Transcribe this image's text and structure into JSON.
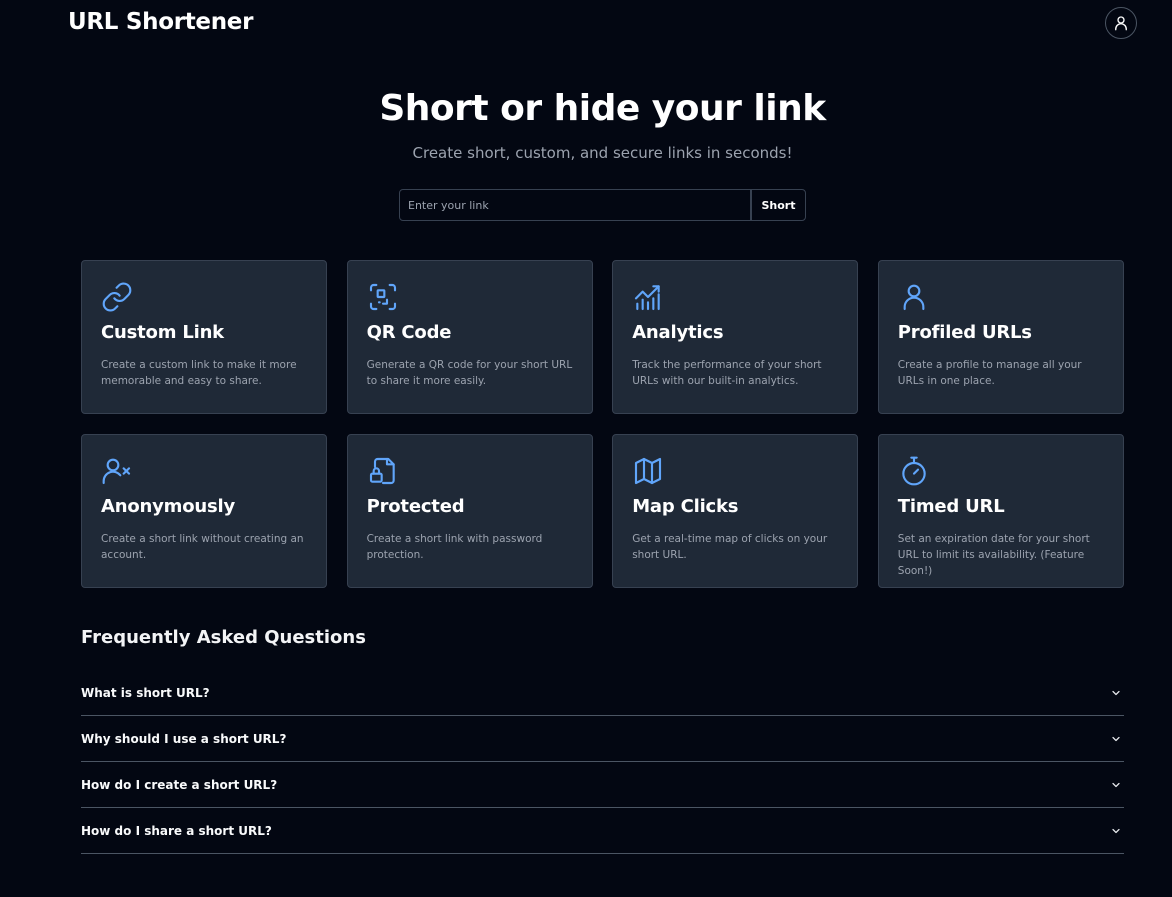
{
  "header": {
    "title": "URL Shortener",
    "account_icon": "user-icon"
  },
  "hero": {
    "title": "Short or hide your link",
    "subtitle": "Create short, custom, and secure links in seconds!"
  },
  "shorten": {
    "placeholder": "Enter your link",
    "value": "",
    "button_label": "Short"
  },
  "colors": {
    "background": "#030712",
    "card": "#1f2937",
    "accent_icon": "#60a5fa",
    "muted_text": "#9ca3af"
  },
  "features": [
    {
      "icon": "link-icon",
      "title": "Custom Link",
      "description": "Create a custom link to make it more memorable and easy to share."
    },
    {
      "icon": "qr-code-icon",
      "title": "QR Code",
      "description": "Generate a QR code for your short URL to share it more easily."
    },
    {
      "icon": "chart-icon",
      "title": "Analytics",
      "description": "Track the performance of your short URLs with our built-in analytics."
    },
    {
      "icon": "user-icon",
      "title": "Profiled URLs",
      "description": "Create a profile to manage all your URLs in one place."
    },
    {
      "icon": "user-x-icon",
      "title": "Anonymously",
      "description": "Create a short link without creating an account."
    },
    {
      "icon": "file-lock-icon",
      "title": "Protected",
      "description": "Create a short link with password protection."
    },
    {
      "icon": "map-icon",
      "title": "Map Clicks",
      "description": "Get a real-time map of clicks on your short URL."
    },
    {
      "icon": "timer-icon",
      "title": "Timed URL",
      "description": "Set an expiration date for your short URL to limit its availability. (Feature Soon!)"
    }
  ],
  "faq": {
    "heading": "Frequently Asked Questions",
    "items": [
      {
        "question": "What is short URL?"
      },
      {
        "question": "Why should I use a short URL?"
      },
      {
        "question": "How do I create a short URL?"
      },
      {
        "question": "How do I share a short URL?"
      }
    ]
  }
}
